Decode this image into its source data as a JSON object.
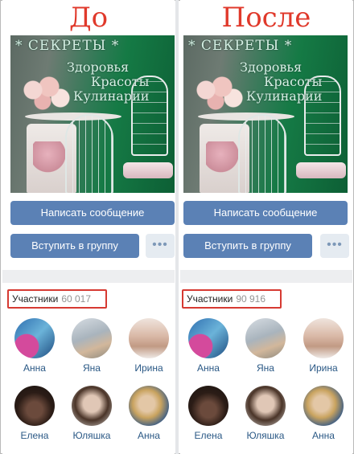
{
  "panels": [
    {
      "label": "До",
      "cover": {
        "title": "СЕКРЕТЫ",
        "line1": "Здоровья",
        "line2": "Красоты",
        "line3": "Кулинарии"
      },
      "buttons": {
        "message": "Написать сообщение",
        "join": "Вступить в группу",
        "more": "•••"
      },
      "members": {
        "label": "Участники",
        "count": "60 017",
        "people": [
          {
            "name": "Анна",
            "avatar": "photo"
          },
          {
            "name": "Яна",
            "avatar": "photo"
          },
          {
            "name": "Ирина",
            "avatar": "photo"
          },
          {
            "name": "Елена",
            "avatar": "photo"
          },
          {
            "name": "Юляшка",
            "avatar": "photo"
          },
          {
            "name": "Анна",
            "avatar": "photo"
          }
        ]
      }
    },
    {
      "label": "После",
      "cover": {
        "title": "СЕКРЕТЫ",
        "line1": "Здоровья",
        "line2": "Красоты",
        "line3": "Кулинарии"
      },
      "buttons": {
        "message": "Написать сообщение",
        "join": "Вступить в группу",
        "more": "•••"
      },
      "members": {
        "label": "Участники",
        "count": "90 916",
        "people": [
          {
            "name": "Анна",
            "avatar": "photo"
          },
          {
            "name": "Яна",
            "avatar": "photo"
          },
          {
            "name": "Ирина",
            "avatar": "photo"
          },
          {
            "name": "Елена",
            "avatar": "photo"
          },
          {
            "name": "Юляшка",
            "avatar": "photo"
          },
          {
            "name": "Анна",
            "avatar": "photo"
          }
        ]
      }
    }
  ],
  "colors": {
    "label_red": "#e0392b",
    "button_blue": "#5b81b5",
    "highlight_box": "#d63a32",
    "link_blue": "#2a5885"
  }
}
